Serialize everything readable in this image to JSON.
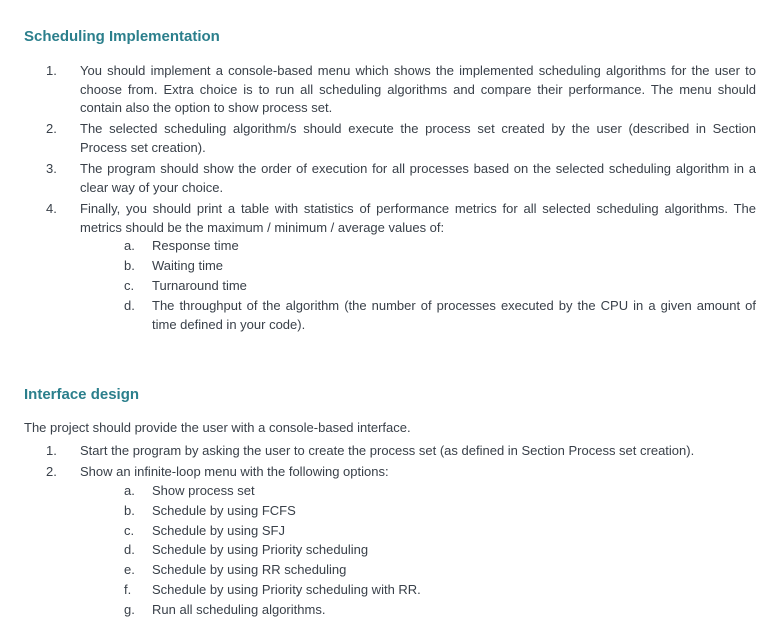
{
  "section1": {
    "heading": "Scheduling Implementation",
    "items": [
      {
        "marker": "1.",
        "text": "You should implement a console-based menu which shows the implemented scheduling algorithms for the user to choose from. Extra choice is to run all scheduling algorithms and compare their performance. The menu should contain also the option to show process set."
      },
      {
        "marker": "2.",
        "text": "The selected scheduling algorithm/s should execute the process set created by the user (described in Section Process set creation)."
      },
      {
        "marker": "3.",
        "text": "The program should show the order of execution for all processes based on the selected scheduling algorithm in a clear way of your choice."
      },
      {
        "marker": "4.",
        "text": "Finally, you should print a table with statistics of performance metrics for all selected scheduling algorithms. The metrics should be the maximum / minimum / average values of:",
        "sub": [
          {
            "marker": "a.",
            "text": "Response time"
          },
          {
            "marker": "b.",
            "text": "Waiting time"
          },
          {
            "marker": "c.",
            "text": "Turnaround time"
          },
          {
            "marker": "d.",
            "text": "The throughput of the algorithm (the number of processes executed by the CPU in a given amount of time defined in your code)."
          }
        ]
      }
    ]
  },
  "section2": {
    "heading": "Interface design",
    "intro": "The project should provide the user with a console-based interface.",
    "items": [
      {
        "marker": "1.",
        "text": "Start the program by asking the user to create the process set (as defined in Section Process set creation)."
      },
      {
        "marker": "2.",
        "text": "Show an infinite-loop menu with the following options:",
        "sub": [
          {
            "marker": "a.",
            "text": "Show process set"
          },
          {
            "marker": "b.",
            "text": "Schedule by using FCFS"
          },
          {
            "marker": "c.",
            "text": "Schedule by using SFJ"
          },
          {
            "marker": "d.",
            "text": "Schedule by using Priority scheduling"
          },
          {
            "marker": "e.",
            "text": "Schedule by using RR scheduling"
          },
          {
            "marker": "f.",
            "text": "Schedule by using Priority scheduling with RR."
          },
          {
            "marker": "g.",
            "text": "Run all scheduling algorithms."
          }
        ]
      }
    ]
  }
}
